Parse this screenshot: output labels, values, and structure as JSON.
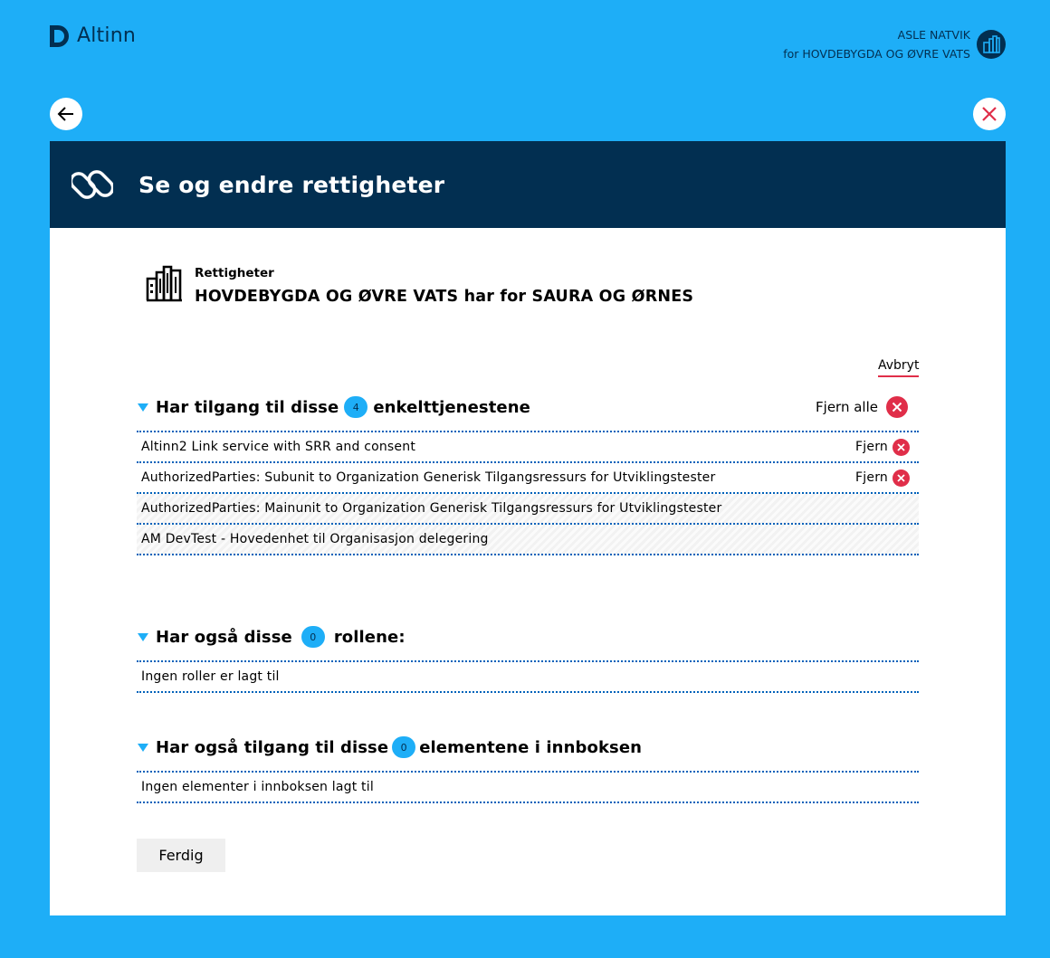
{
  "app": {
    "logo_text": "Altinn"
  },
  "user": {
    "name": "ASLE NATVIK",
    "org": "for HOVDEBYGDA OG ØVRE VATS"
  },
  "panel": {
    "title": "Se og endre rettigheter"
  },
  "reporter": {
    "label": "Rettigheter",
    "name": "HOVDEBYGDA OG ØVRE VATS har for SAURA OG ØRNES"
  },
  "cancel_label": "Avbryt",
  "services": {
    "heading_pre": "Har tilgang til disse",
    "count": "4",
    "heading_post": "enkelttjenestene",
    "remove_all": "Fjern alle",
    "remove_label": "Fjern",
    "items": [
      {
        "name": "Altinn2 Link service with SRR and consent",
        "removable": true
      },
      {
        "name": "AuthorizedParties: Subunit to Organization Generisk Tilgangsressurs for Utviklingstester",
        "removable": true
      },
      {
        "name": "AuthorizedParties: Mainunit to Organization Generisk Tilgangsressurs for Utviklingstester",
        "removable": false
      },
      {
        "name": "AM DevTest - Hovedenhet til Organisasjon delegering",
        "removable": false
      }
    ]
  },
  "roles": {
    "heading_pre": "Har også disse",
    "count": "0",
    "heading_post": "rollene:",
    "empty": "Ingen roller er lagt til"
  },
  "inbox": {
    "heading_pre": "Har også tilgang til disse",
    "count": "0",
    "heading_post": "elementene i innboksen",
    "empty": "Ingen elementer i innboksen lagt til"
  },
  "done_label": "Ferdig",
  "colors": {
    "background": "#1eaef7",
    "navy": "#022f51",
    "danger": "#e02e49",
    "divider": "#0062ba"
  }
}
